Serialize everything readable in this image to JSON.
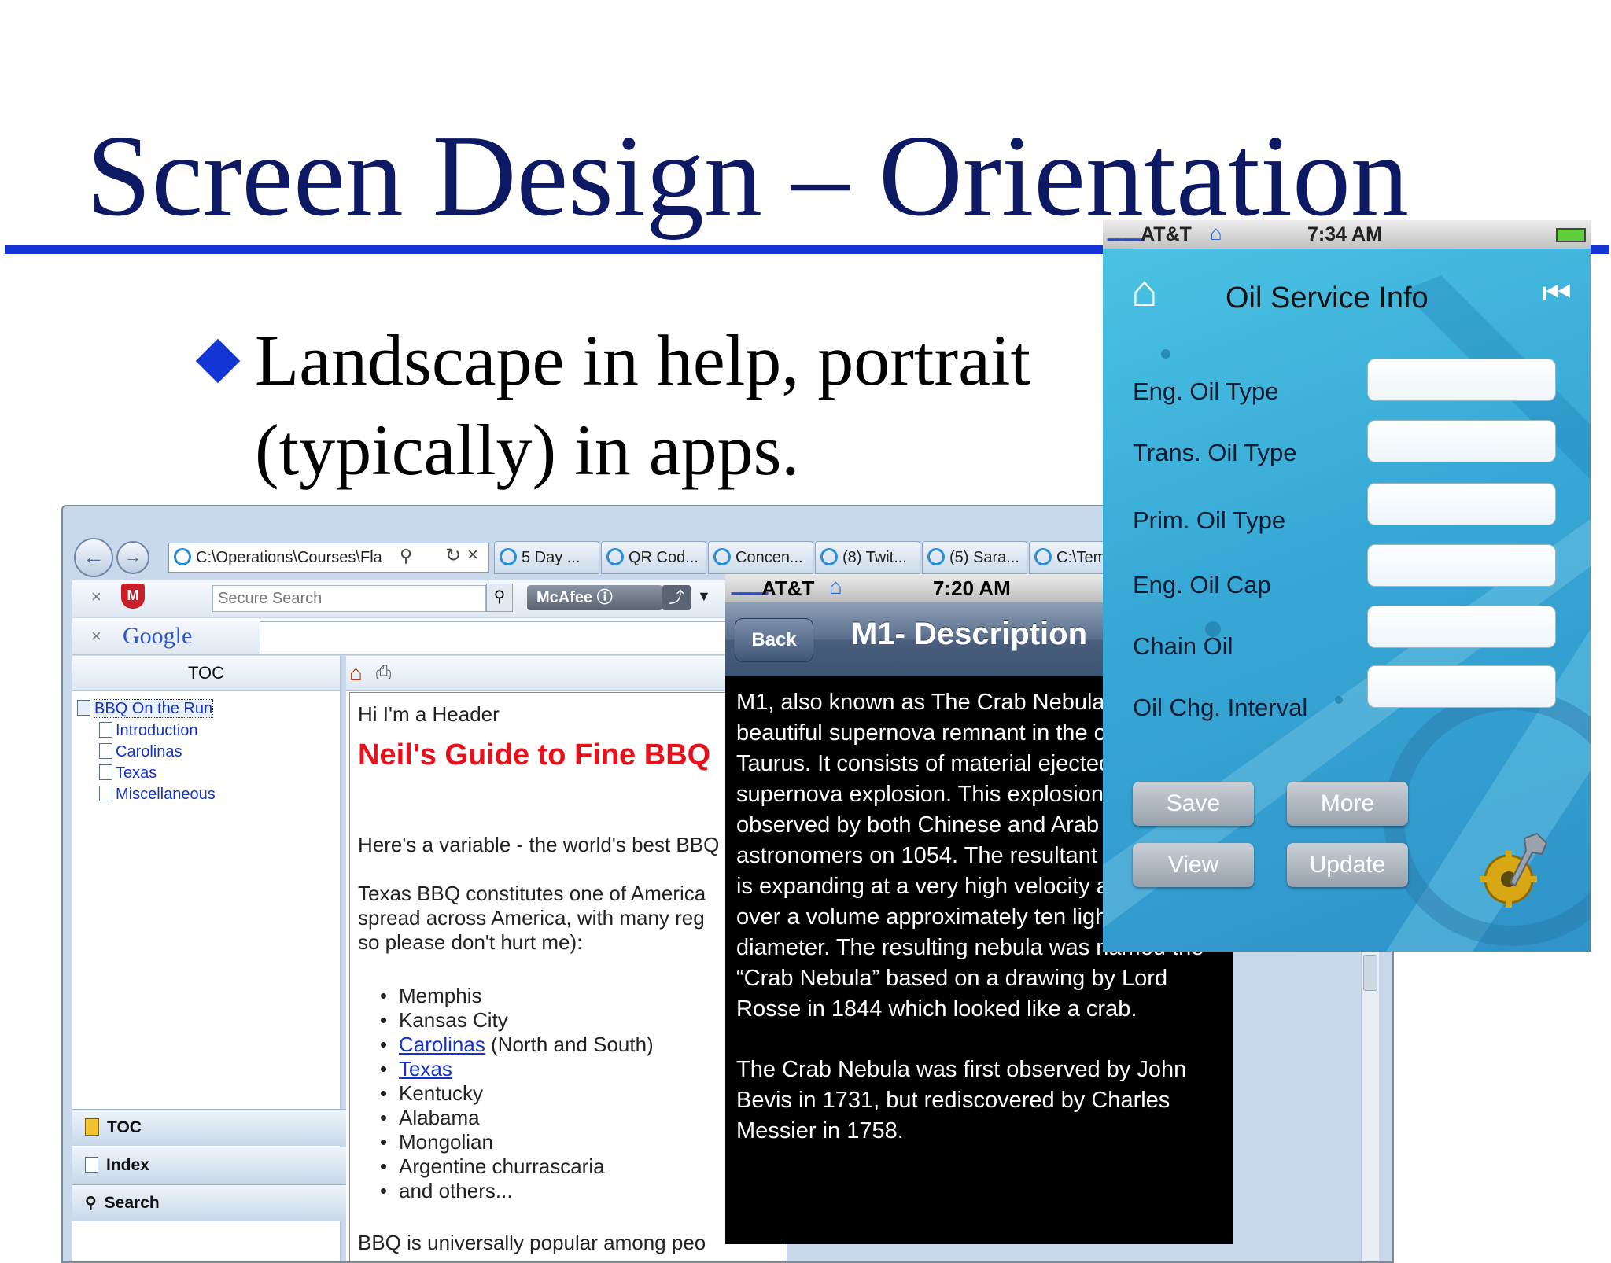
{
  "slide": {
    "title": "Screen Design – Orientation",
    "bullet_line1": "Landscape in help, portrait",
    "bullet_line2": "(typically) in apps."
  },
  "browser": {
    "address": "C:\\Operations\\Courses\\Fla",
    "tabs": [
      "5 Day ...",
      "QR Cod...",
      "Concen...",
      "(8) Twit...",
      "(5) Sara...",
      "C:\\Tem..."
    ],
    "secure_search_placeholder": "Secure Search",
    "mcafee_label": "McAfee",
    "google_label": "Google",
    "toc_header": "TOC",
    "toc_root": "BBQ On the Run",
    "toc_items": [
      "Introduction",
      "Carolinas",
      "Texas",
      "Miscellaneous"
    ],
    "side_buttons": [
      "TOC",
      "Index",
      "Search"
    ],
    "content": {
      "header": "Hi I'm a Header",
      "headline": "Neil's Guide to Fine BBQ",
      "variable_line": "Here's a variable - the world's best BBQ",
      "para_line1": "Texas BBQ constitutes one of America",
      "para_line2": "spread across America, with many reg",
      "para_line3": "so please don't hurt me):",
      "list": {
        "memphis": "Memphis",
        "kansas": "Kansas City",
        "carolinas_link": "Carolinas",
        "carolinas_rest": " (North and South)",
        "texas_link": "Texas",
        "kentucky": "Kentucky",
        "alabama": "Alabama",
        "mongolian": "Mongolian",
        "argentine": "Argentine churrascaria",
        "others": "and others..."
      },
      "footer_line": "BBQ is universally popular among peo"
    }
  },
  "phone1": {
    "carrier": "AT&T",
    "time": "7:20 AM",
    "back_label": "Back",
    "title": "M1- Description",
    "para1": "M1, also known as The Crab Nebula, is a beautiful supernova remnant in the constellation Taurus. It consists of material ejected in a violent supernova explosion. This explosion was observed by both Chinese and Arab astronomers on 1054. The resultant cloud of gas is expanding at a very high velocity and spread over a volume approximately ten light years in diameter. The resulting nebula was named the “Crab Nebula” based on a drawing by Lord Rosse in 1844 which looked like a crab.",
    "para2": "The Crab Nebula was first observed by John Bevis in 1731, but rediscovered by Charles Messier in 1758."
  },
  "phone2": {
    "carrier": "AT&T",
    "time": "7:34 AM",
    "title": "Oil Service Info",
    "fields": [
      "Eng. Oil Type",
      "Trans. Oil Type",
      "Prim. Oil Type",
      "Eng. Oil Cap",
      "Chain Oil",
      "Oil Chg. Interval"
    ],
    "buttons": {
      "save": "Save",
      "more": "More",
      "view": "View",
      "update": "Update"
    }
  },
  "colors": {
    "title": "#0d1a63",
    "rule": "#1436d4",
    "headline_red": "#e8101a",
    "link_blue": "#1533c8",
    "phone2_bg": "#37a8d6"
  },
  "icons": [
    "diamond-bullet",
    "back-arrow-icon",
    "forward-arrow-icon",
    "ie-page-icon",
    "search-icon",
    "refresh-icon",
    "close-icon",
    "mcafee-shield-icon",
    "home-icon",
    "print-icon",
    "book-icon",
    "page-icon",
    "wifi-icon",
    "battery-icon",
    "skip-back-icon",
    "gear-wrench-icon"
  ]
}
